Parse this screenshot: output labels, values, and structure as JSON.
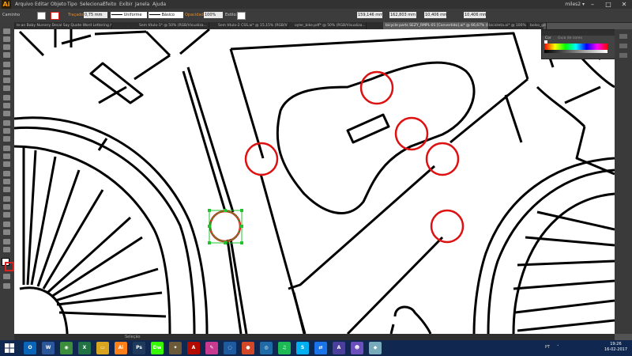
{
  "app": {
    "logo": "Ai",
    "window_title": "miles2 ▾"
  },
  "menubar": {
    "items": [
      "Arquivo",
      "Editar",
      "Objeto",
      "Tipo",
      "Selecionar",
      "Efeito",
      "Exibir",
      "Janela",
      "Ajuda"
    ]
  },
  "controlbar": {
    "path_label": "Caminho",
    "stroke_label": "Traçado:",
    "stroke_value": "0,75 mm",
    "profile_value": "Uniforme",
    "brush_value": "Básico",
    "opacity_label": "Opacidade:",
    "opacity_value": "100%",
    "style_label": "Estilo:",
    "x_value": "159,146 mm",
    "y_value": "162,803 mm",
    "w_value": "10,406 mm",
    "h_value": "10,406 mm"
  },
  "tabs": [
    "le-an Baby Nursery Decal Say Quote Word Lettering Art Vinyl.jpg*",
    "Sem título-1* @ 50% (RGB/Visualiza...",
    "Sem título-2 CSS.ai* @ 15,15% (RGB/Visualiza...",
    "oyler_bike.pdf* @ 50% (RGB/Visualiza...",
    "bicycle parts SEZY_RMPL-01 [Convertido].ai* @ 66,67% (CMYK/...",
    "bicicleta.ai* @ 100% (RGB/Visualiza...",
    "bolso_geotour_final..."
  ],
  "color_panel": {
    "tabs": [
      "Cor",
      "Guia de cores"
    ]
  },
  "statusbar": {
    "selection": "Seleção"
  },
  "taskbar": {
    "apps": [
      {
        "name": "outlook",
        "label": "O",
        "color": "#0a64b8"
      },
      {
        "name": "word",
        "label": "W",
        "color": "#2b579a"
      },
      {
        "name": "chrome",
        "label": "◉",
        "color": "#3c8d3c"
      },
      {
        "name": "excel",
        "label": "X",
        "color": "#217346"
      },
      {
        "name": "file-explorer",
        "label": "▭",
        "color": "#d9a520"
      },
      {
        "name": "illustrator",
        "label": "Ai",
        "color": "#ff7f18"
      },
      {
        "name": "photoshop",
        "label": "Ps",
        "color": "#1f3a5a"
      },
      {
        "name": "dreamweaver",
        "label": "Dw",
        "color": "#35fa00"
      },
      {
        "name": "app-9",
        "label": "✦",
        "color": "#6a5a3a"
      },
      {
        "name": "acrobat",
        "label": "A",
        "color": "#b30b00"
      },
      {
        "name": "paint",
        "label": "✎",
        "color": "#c73a8f"
      },
      {
        "name": "app-12",
        "label": "◌",
        "color": "#1e5aa0"
      },
      {
        "name": "app-13",
        "label": "●",
        "color": "#d24726"
      },
      {
        "name": "app-14",
        "label": "◎",
        "color": "#1e6ba8"
      },
      {
        "name": "spotify",
        "label": "♫",
        "color": "#1db954"
      },
      {
        "name": "skype",
        "label": "S",
        "color": "#00aff0"
      },
      {
        "name": "teamviewer",
        "label": "⇄",
        "color": "#1a73e8"
      },
      {
        "name": "app-18",
        "label": "A",
        "color": "#4a3f9a"
      },
      {
        "name": "app-19",
        "label": "☻",
        "color": "#6b4fbb"
      },
      {
        "name": "app-20",
        "label": "◆",
        "color": "#7ab"
      }
    ],
    "lang": "PT",
    "time": "19:26",
    "date": "16-02-2017"
  },
  "colors": {
    "highlight_circle": "#dd1111",
    "selection": "#21c42e",
    "menubar_bg": "#323232"
  }
}
